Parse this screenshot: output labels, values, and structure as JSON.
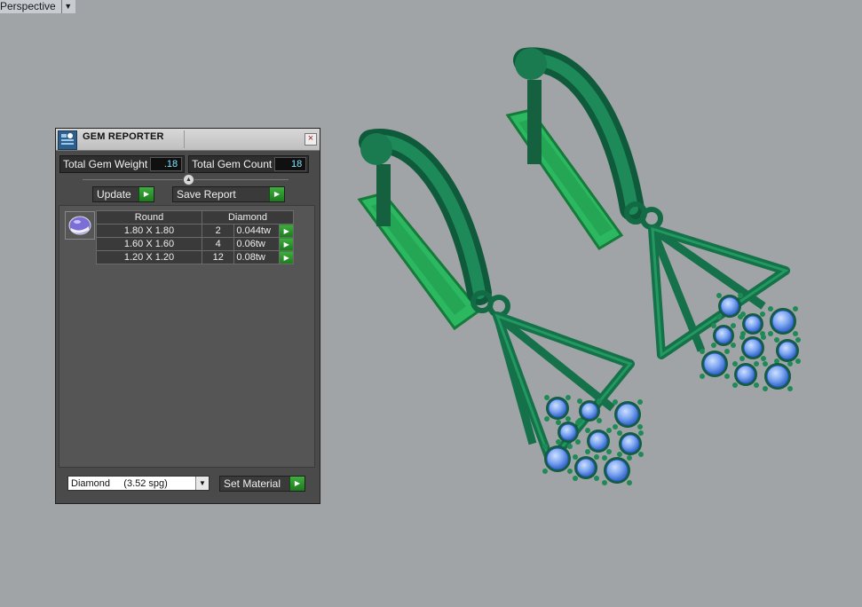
{
  "viewport": {
    "label": "Perspective"
  },
  "panel": {
    "title": "GEM REPORTER",
    "total_weight_label": "Total Gem Weight",
    "total_weight_value": ".18",
    "total_count_label": "Total Gem Count",
    "total_count_value": "18",
    "update_label": "Update",
    "save_report_label": "Save Report",
    "table": {
      "headers": [
        "Round",
        "Diamond"
      ],
      "rows": [
        {
          "size": "1.80 X 1.80",
          "count": "2",
          "weight": "0.044tw"
        },
        {
          "size": "1.60 X 1.60",
          "count": "4",
          "weight": "0.06tw"
        },
        {
          "size": "1.20 X 1.20",
          "count": "12",
          "weight": "0.08tw"
        }
      ]
    },
    "material_select": "Diamond     (3.52 spg)",
    "set_material_label": "Set Material"
  },
  "colors": {
    "metal": "#1c6b4a",
    "gem": "#7aa4f0",
    "background": "#a0a4a6",
    "accent_green": "#2e9a2e"
  }
}
